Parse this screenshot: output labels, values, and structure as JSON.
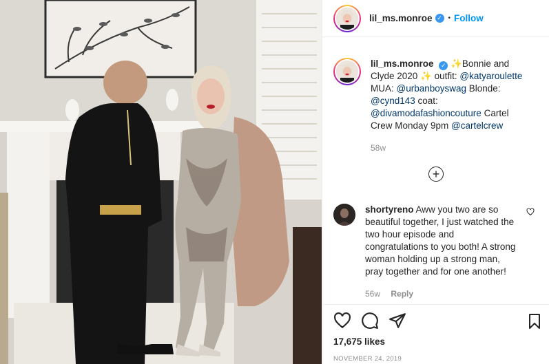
{
  "post": {
    "header": {
      "username": "lil_ms.monroe",
      "verified_icon": "verified-badge-icon",
      "separator": "•",
      "follow_label": "Follow"
    },
    "caption": {
      "username": "lil_ms.monroe",
      "emoji1": "✨",
      "text1": "Bonnie and Clyde 2020 ",
      "emoji2": "✨",
      "text2": " outfit: ",
      "mention_outfit": "@katyaroulette",
      "text3": " MUA: ",
      "mention_mua": "@urbanboyswag",
      "text4": " Blonde: ",
      "mention_blonde": "@cynd143",
      "text5": " coat: ",
      "mention_coat": "@divamodafashioncouture",
      "text6": " Cartel Crew Monday 9pm ",
      "mention_show": "@cartelcrew",
      "time": "58w"
    },
    "load_more_label": "+",
    "comment": {
      "username": "shortyreno",
      "text": "Aww you two are so beautiful together, I just watched the two hour episode and congratulations to you both! A strong woman holding up a strong man, pray together and for one another!",
      "time": "56w",
      "reply_label": "Reply"
    },
    "likes": "17,675 likes",
    "date": "NOVEMBER 24, 2019"
  },
  "colors": {
    "accent": "#0095f6",
    "link": "#00376b",
    "muted": "#8e8e8e",
    "text": "#262626",
    "border": "#efefef"
  },
  "icons": [
    "heart-icon",
    "comment-icon",
    "share-icon",
    "bookmark-icon",
    "add-circle-icon",
    "like-comment-icon"
  ]
}
